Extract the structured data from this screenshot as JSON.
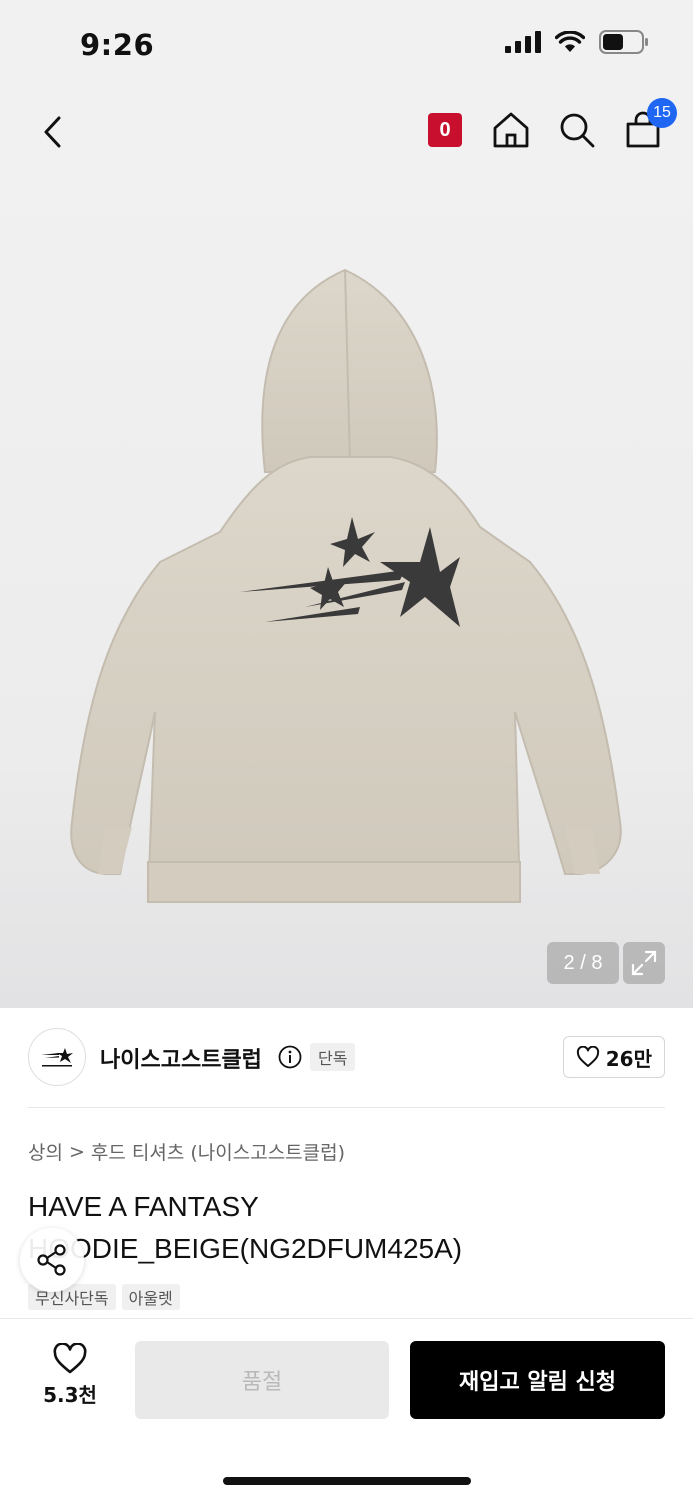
{
  "status_bar": {
    "time": "9:26"
  },
  "nav": {
    "brand_badge": "0",
    "cart_count": "15"
  },
  "gallery": {
    "page_indicator": "2 / 8",
    "current_page": 2,
    "total_pages": 8
  },
  "brand": {
    "name": "나이스고스트클럽",
    "exclusive_tag": "단독",
    "likes": "26만"
  },
  "breadcrumb": {
    "category": "상의",
    "separator": ">",
    "subcategory": "후드 티셔츠 (나이스고스트클럽)"
  },
  "product": {
    "title": "HAVE A FANTASY HOODIE_BEIGE(NG2DFUM425A)",
    "tags": [
      "무신사단독",
      "아울렛"
    ]
  },
  "bottom": {
    "wish_count": "5.3천",
    "soldout_label": "품절",
    "restock_label": "재입고 알림 신청"
  },
  "colors": {
    "accent_blue": "#1f66f2",
    "brand_red": "#c8102e",
    "hoodie": "#d8d2c6",
    "print": "#3a3a3a"
  }
}
